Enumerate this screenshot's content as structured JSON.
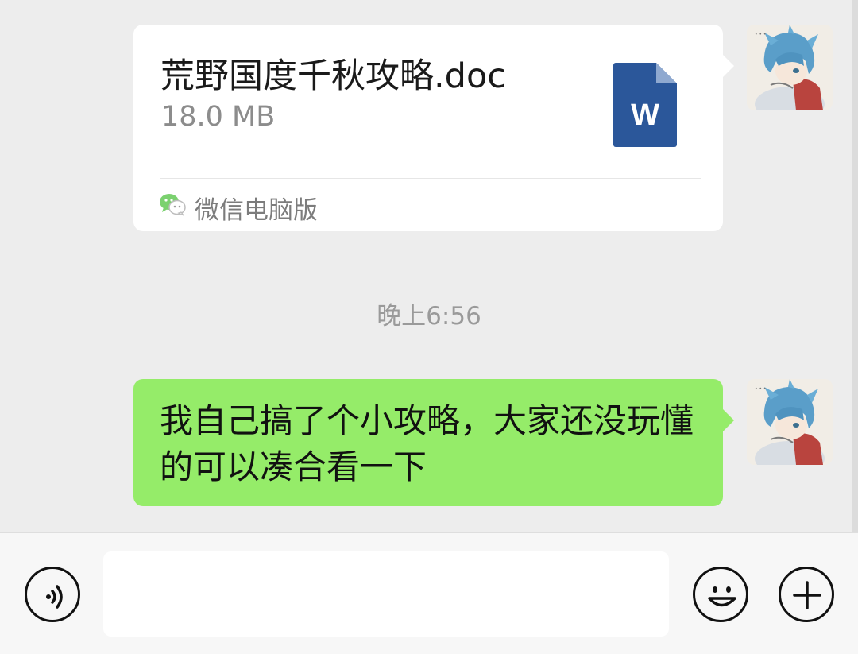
{
  "chat": {
    "file_message": {
      "file_name": "荒野国度千秋攻略.doc",
      "file_size": "18.0 MB",
      "file_icon_letter": "W",
      "source_label": "微信电脑版"
    },
    "timestamp": "晚上6:56",
    "text_message": {
      "text": "我自己搞了个小攻略，大家还没玩懂的可以凑合看一下"
    }
  },
  "input_bar": {
    "voice_icon": "voice-icon",
    "input_value": "",
    "emoji_icon": "emoji-icon",
    "add_icon": "plus-icon"
  },
  "colors": {
    "chat_background": "#ededed",
    "outgoing_bubble": "#95ec69",
    "card_background": "#ffffff",
    "word_blue": "#2b579a",
    "wechat_green": "#07c160"
  }
}
